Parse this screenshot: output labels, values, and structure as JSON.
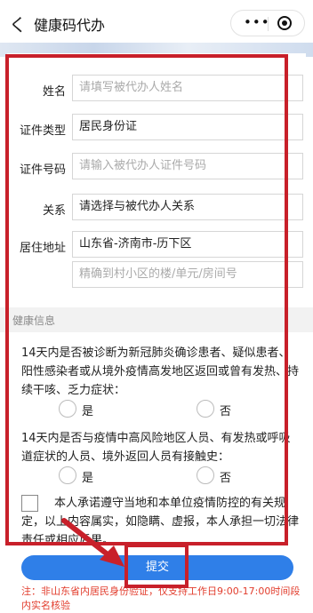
{
  "header": {
    "back_glyph": "く",
    "title": "健康码代办",
    "more_glyph": "•••"
  },
  "form": {
    "name_label": "姓名",
    "name_placeholder": "请填写被代办人姓名",
    "id_type_label": "证件类型",
    "id_type_value": "居民身份证",
    "id_no_label": "证件号码",
    "id_no_placeholder": "请输入被代办人证件号码",
    "relation_label": "关系",
    "relation_value": "请选择与被代办人关系",
    "address_label": "居住地址",
    "address_value": "山东省-济南市-历下区",
    "address_detail_placeholder": "精确到村小区的楼/单元/房间号"
  },
  "health": {
    "section_title": "健康信息",
    "q1_text": "14天内是否被诊断为新冠肺炎确诊患者、疑似患者、阳性感染者或从境外疫情高发地区返回或曾有发热、持续干咳、乏力症状：",
    "q1_yes": "是",
    "q1_no": "否",
    "q2_text": "14天内是否与疫情中高风险地区人员、有发热或呼吸道症状的人员、境外返回人员有接触史：",
    "q2_yes": "是",
    "q2_no": "否",
    "promise_text": "本人承诺遵守当地和本单位疫情防控的有关规定，以上内容属实，如隐瞒、虚报，本人承担一切法律责任或相应后果。"
  },
  "actions": {
    "submit_label": "提交"
  },
  "notice": {
    "text": "注：非山东省内居民身份验证，仅支持工作日9:00-17:00时间段内实名核验"
  },
  "colors": {
    "accent": "#2f7fe8",
    "highlight": "#c8202a",
    "notice": "#e23d2d"
  }
}
